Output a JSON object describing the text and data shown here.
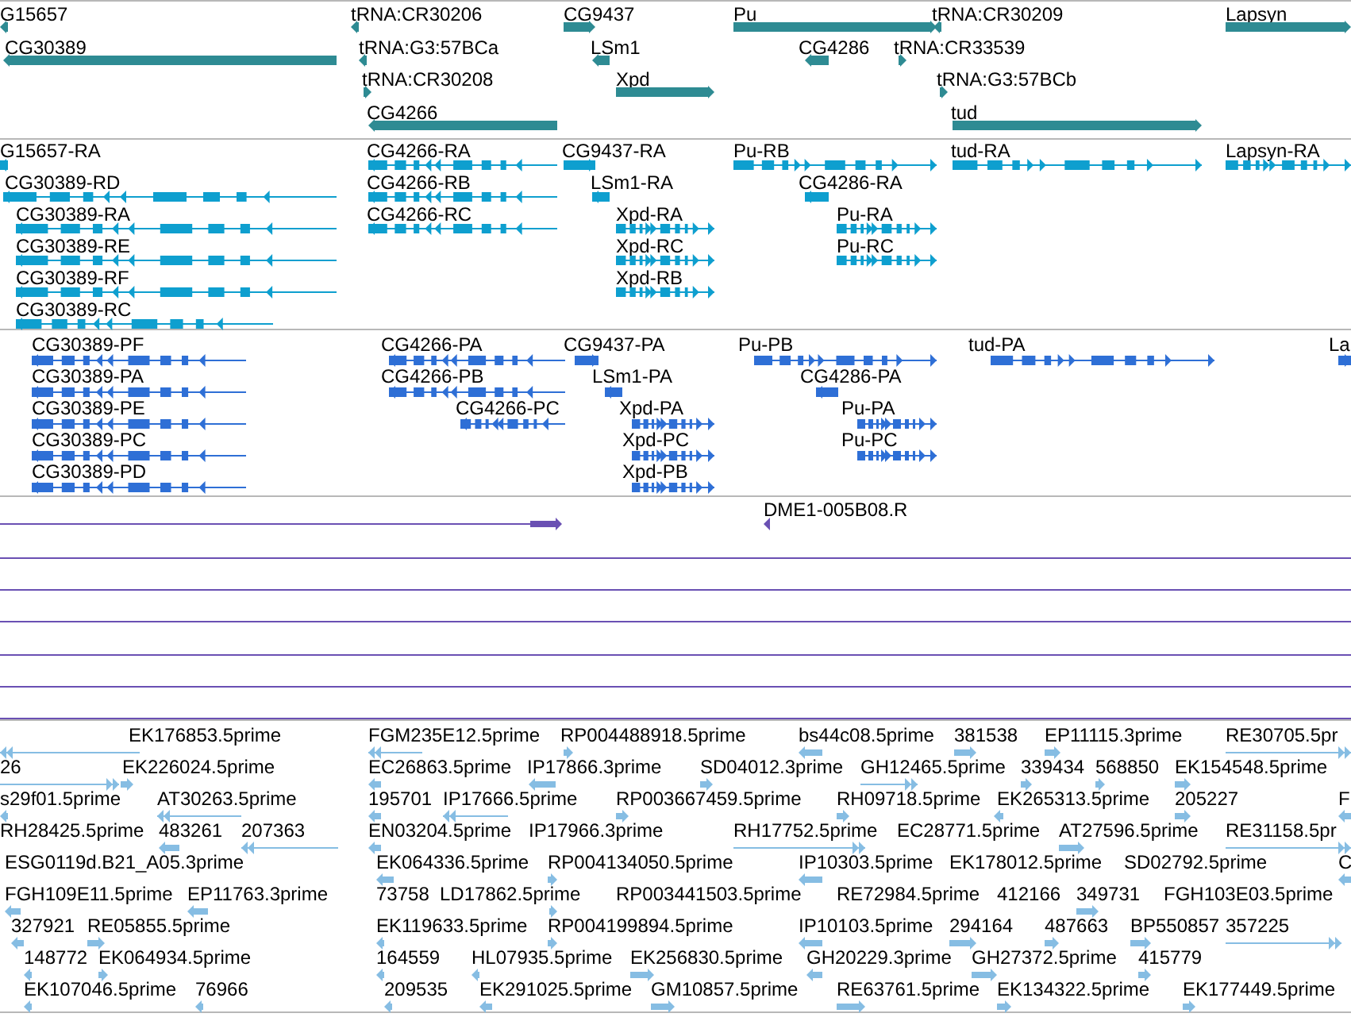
{
  "tracks": [
    {
      "kind": "gene",
      "features": [
        {
          "label": "G15657",
          "reverse": true
        },
        {
          "label": "CG30389",
          "reverse": true
        },
        {
          "label": "tRNA:CR30206",
          "reverse": true
        },
        {
          "label": "tRNA:G3:57BCa",
          "reverse": true
        },
        {
          "label": "tRNA:CR30208",
          "reverse": false
        },
        {
          "label": "CG4266",
          "reverse": true
        },
        {
          "label": "CG9437",
          "reverse": false
        },
        {
          "label": "LSm1",
          "reverse": true
        },
        {
          "label": "Xpd",
          "reverse": false
        },
        {
          "label": "Pu",
          "reverse": false
        },
        {
          "label": "CG4286",
          "reverse": true
        },
        {
          "label": "tRNA:CR30209",
          "reverse": true
        },
        {
          "label": "tRNA:CR33539",
          "reverse": false
        },
        {
          "label": "tRNA:G3:57BCb",
          "reverse": false
        },
        {
          "label": "tud",
          "reverse": false
        },
        {
          "label": "Lapsyn",
          "reverse": false
        }
      ]
    },
    {
      "kind": "transcript",
      "features": [
        {
          "label": "G15657-RA",
          "reverse": true
        },
        {
          "label": "CG30389-RD",
          "reverse": true
        },
        {
          "label": "CG30389-RA",
          "reverse": true
        },
        {
          "label": "CG30389-RE",
          "reverse": true
        },
        {
          "label": "CG30389-RF",
          "reverse": true
        },
        {
          "label": "CG30389-RC",
          "reverse": true
        },
        {
          "label": "CG4266-RA",
          "reverse": true
        },
        {
          "label": "CG4266-RB",
          "reverse": true
        },
        {
          "label": "CG4266-RC",
          "reverse": true
        },
        {
          "label": "CG9437-RA",
          "reverse": false
        },
        {
          "label": "LSm1-RA",
          "reverse": true
        },
        {
          "label": "Xpd-RA",
          "reverse": false
        },
        {
          "label": "Xpd-RC",
          "reverse": false
        },
        {
          "label": "Xpd-RB",
          "reverse": false
        },
        {
          "label": "Pu-RB",
          "reverse": false
        },
        {
          "label": "CG4286-RA",
          "reverse": true
        },
        {
          "label": "Pu-RA",
          "reverse": false
        },
        {
          "label": "Pu-RC",
          "reverse": false
        },
        {
          "label": "tud-RA",
          "reverse": false
        },
        {
          "label": "Lapsyn-RA",
          "reverse": false
        }
      ]
    },
    {
      "kind": "protein",
      "features": [
        {
          "label": "CG30389-PF",
          "reverse": true
        },
        {
          "label": "CG30389-PA",
          "reverse": true
        },
        {
          "label": "CG30389-PE",
          "reverse": true
        },
        {
          "label": "CG30389-PC",
          "reverse": true
        },
        {
          "label": "CG30389-PD",
          "reverse": true
        },
        {
          "label": "CG4266-PA",
          "reverse": true
        },
        {
          "label": "CG4266-PB",
          "reverse": true
        },
        {
          "label": "CG4266-PC",
          "reverse": true
        },
        {
          "label": "CG9437-PA",
          "reverse": false
        },
        {
          "label": "LSm1-PA",
          "reverse": true
        },
        {
          "label": "Xpd-PA",
          "reverse": false
        },
        {
          "label": "Xpd-PC",
          "reverse": false
        },
        {
          "label": "Xpd-PB",
          "reverse": false
        },
        {
          "label": "Pu-PB",
          "reverse": false
        },
        {
          "label": "CG4286-PA",
          "reverse": true
        },
        {
          "label": "Pu-PA",
          "reverse": false
        },
        {
          "label": "Pu-PC",
          "reverse": false
        },
        {
          "label": "tud-PA",
          "reverse": false
        },
        {
          "label": "La",
          "reverse": false
        }
      ]
    },
    {
      "kind": "clone",
      "features": [
        {
          "reverse": false
        },
        {
          "label": "DME1-005B08.R",
          "reverse": true
        }
      ]
    },
    {
      "kind": "est",
      "features": [
        {
          "label": "EK176853.5prime",
          "reverse": true
        },
        {
          "label": "FGM235E12.5prime",
          "reverse": true
        },
        {
          "label": "RP004488918.5prime",
          "reverse": false
        },
        {
          "label": "bs44c08.5prime",
          "reverse": true
        },
        {
          "label": "381538",
          "reverse": false
        },
        {
          "label": "EP11115.3prime",
          "reverse": false
        },
        {
          "label": "RE30705.5pr",
          "reverse": false
        },
        {
          "label": "26",
          "reverse": false
        },
        {
          "label": "EK226024.5prime",
          "reverse": false
        },
        {
          "label": "EC26863.5prime",
          "reverse": true
        },
        {
          "label": "IP17866.3prime",
          "reverse": true
        },
        {
          "label": "SD04012.3prime",
          "reverse": false
        },
        {
          "label": "GH12465.5prime",
          "reverse": false
        },
        {
          "label": "339434",
          "reverse": false
        },
        {
          "label": "568850",
          "reverse": false
        },
        {
          "label": "EK154548.5prime",
          "reverse": false
        },
        {
          "label": "s29f01.5prime",
          "reverse": true
        },
        {
          "label": "AT30263.5prime",
          "reverse": true
        },
        {
          "label": "195701",
          "reverse": true
        },
        {
          "label": "IP17666.5prime",
          "reverse": true
        },
        {
          "label": "RP003667459.5prime",
          "reverse": false
        },
        {
          "label": "RH09718.5prime",
          "reverse": false
        },
        {
          "label": "EK265313.5prime",
          "reverse": true
        },
        {
          "label": "205227",
          "reverse": false
        },
        {
          "label": "F",
          "reverse": true
        },
        {
          "label": "RH28425.5prime"
        },
        {
          "label": "483261",
          "reverse": true
        },
        {
          "label": "207363",
          "reverse": true
        },
        {
          "label": "EN03204.5prime",
          "reverse": true
        },
        {
          "label": "IP17966.3prime"
        },
        {
          "label": "RH17752.5prime",
          "reverse": false
        },
        {
          "label": "EC28771.5prime"
        },
        {
          "label": "AT27596.5prime",
          "reverse": false
        },
        {
          "label": "RE31158.5pr",
          "reverse": false
        },
        {
          "label": "ESG0119d.B21_A05.3prime"
        },
        {
          "label": "EK064336.5prime",
          "reverse": true
        },
        {
          "label": "RP004134050.5prime",
          "reverse": false
        },
        {
          "label": "IP10303.5prime",
          "reverse": true
        },
        {
          "label": "EK178012.5prime"
        },
        {
          "label": "SD02792.5prime"
        },
        {
          "label": "C",
          "reverse": true
        },
        {
          "label": "FGH109E11.5prime",
          "reverse": true
        },
        {
          "label": "EP11763.3prime",
          "reverse": true
        },
        {
          "label": "73758"
        },
        {
          "label": "LD17862.5prime",
          "reverse": false
        },
        {
          "label": "RP003441503.5prime"
        },
        {
          "label": "RE72984.5prime"
        },
        {
          "label": "412166"
        },
        {
          "label": "349731",
          "reverse": false
        },
        {
          "label": "FGH103E03.5prime"
        },
        {
          "label": "327921",
          "reverse": true
        },
        {
          "label": "RE05855.5prime",
          "reverse": false
        },
        {
          "label": "EK119633.5prime",
          "reverse": true
        },
        {
          "label": "RP004199894.5prime",
          "reverse": false
        },
        {
          "label": "IP10103.5prime",
          "reverse": true
        },
        {
          "label": "294164",
          "reverse": false
        },
        {
          "label": "487663",
          "reverse": false
        },
        {
          "label": "BP550857",
          "reverse": false
        },
        {
          "label": "357225",
          "reverse": false
        },
        {
          "label": "148772",
          "reverse": true
        },
        {
          "label": "EK064934.5prime",
          "reverse": false
        },
        {
          "label": "164559",
          "reverse": true
        },
        {
          "label": "HL07935.5prime",
          "reverse": true
        },
        {
          "label": "EK256830.5prime",
          "reverse": false
        },
        {
          "label": "GH20229.3prime",
          "reverse": true
        },
        {
          "label": "GH27372.5prime",
          "reverse": false
        },
        {
          "label": "415779",
          "reverse": false
        },
        {
          "label": "EK107046.5prime",
          "reverse": true
        },
        {
          "label": "76966",
          "reverse": true
        },
        {
          "label": "209535",
          "reverse": true
        },
        {
          "label": "EK291025.5prime",
          "reverse": true
        },
        {
          "label": "GM10857.5prime",
          "reverse": false
        },
        {
          "label": "RE63761.5prime",
          "reverse": false
        },
        {
          "label": "EK134322.5prime",
          "reverse": false
        },
        {
          "label": "EK177449.5prime",
          "reverse": false
        }
      ]
    }
  ]
}
